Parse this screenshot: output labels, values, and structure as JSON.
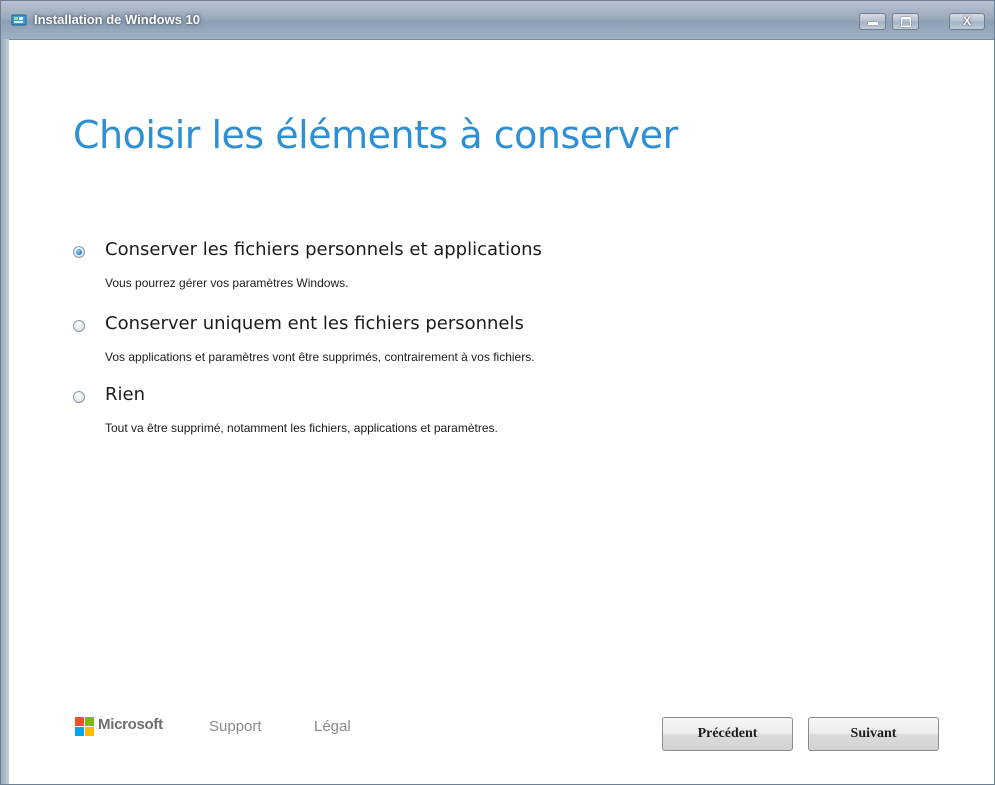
{
  "window": {
    "title": "Installation de Windows 10",
    "close_glyph": "X"
  },
  "page": {
    "heading": "Choisir les éléments à conserver"
  },
  "options": [
    {
      "label": "Conserver les fichiers personnels et applications",
      "description": "Vous pourrez gérer vos paramètres Windows.",
      "selected": true
    },
    {
      "label": "Conserver uniquem ent les fichiers personnels",
      "description": "Vos applications et paramètres vont être supprimés, contrairement à vos fichiers.",
      "selected": false
    },
    {
      "label": "Rien",
      "description": "Tout va être supprimé, notamment les fichiers, applications et paramètres.",
      "selected": false
    }
  ],
  "footer": {
    "brand": "Microsoft",
    "links": [
      "Support",
      "Légal"
    ],
    "prev_label": "Précédent",
    "next_label": "Suivant"
  },
  "colors": {
    "heading": "#2f8fd3",
    "ms_red": "#f25022",
    "ms_green": "#7fba00",
    "ms_blue": "#00a4ef",
    "ms_yellow": "#ffb900"
  },
  "icons": {
    "title": "windows-setup-icon",
    "brand": "microsoft-logo-icon"
  }
}
